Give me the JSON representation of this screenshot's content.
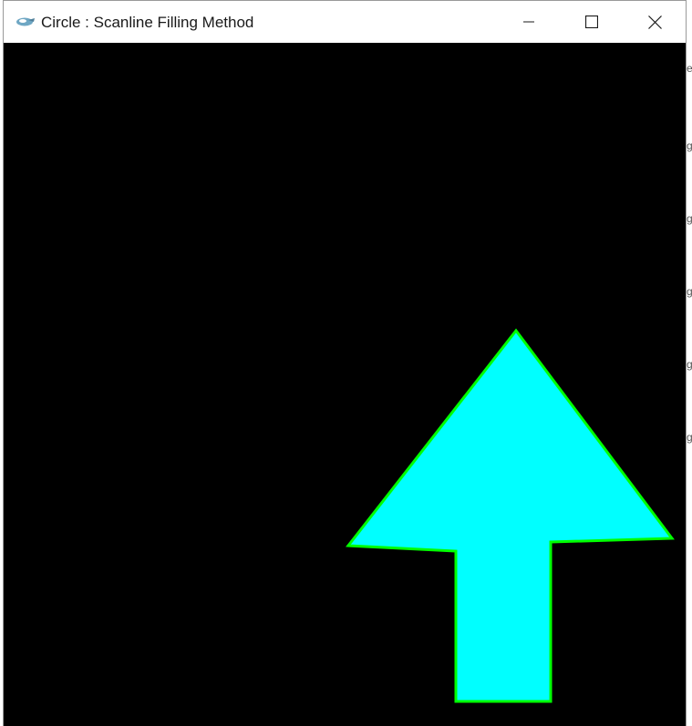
{
  "window": {
    "title": "Circle : Scanline Filling Method",
    "controls": {
      "minimize": "minimize-icon",
      "maximize": "maximize-icon",
      "close": "close-icon"
    }
  },
  "canvas": {
    "background_color": "#000000",
    "shape": {
      "type": "arrow-up polygon",
      "fill_color": "#00ffff",
      "outline_color": "#00ff00"
    }
  },
  "colors": {
    "titlebar": "#ffffff",
    "title_text": "#1a1a1a"
  }
}
